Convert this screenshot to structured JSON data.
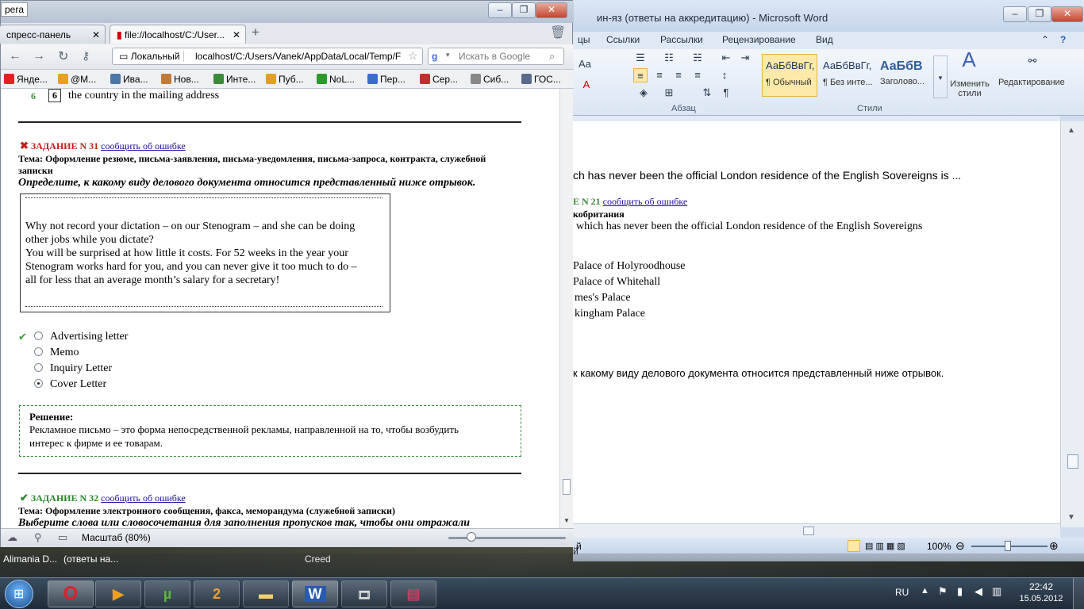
{
  "word": {
    "title": "ин-яз (ответы на аккредитацию)  -  Microsoft Word",
    "tabs": [
      "цы",
      "Ссылки",
      "Рассылки",
      "Рецензирование",
      "Вид"
    ],
    "font_preview": "Aa",
    "groups": {
      "paragraph": "Абзац",
      "styles": "Стили"
    },
    "styles": [
      {
        "sample": "АаБбВвГг,",
        "name": "¶ Обычный"
      },
      {
        "sample": "АаБбВвГг,",
        "name": "¶ Без инте..."
      },
      {
        "sample": "АаБбВ",
        "name": "Заголово..."
      }
    ],
    "change_styles": "Изменить стили",
    "editing": "Редактирование",
    "doc": {
      "line1": "ch has never been the official London residence of the English Sovereigns is ...",
      "task_num": "Е N 21",
      "report_link": "сообщить об ошибке",
      "topic": "кобритания",
      "question": "which has never been the official London residence of the English Sovereigns",
      "options": [
        "Palace of Holyroodhouse",
        "Palace of Whitehall",
        "mes's Palace",
        "kingham Palace"
      ],
      "line_ru": "к какому виду делового документа относится представленный ниже отрывок."
    },
    "status": {
      "left": "й",
      "zoom": "100%"
    }
  },
  "opera": {
    "title_fragment": "pera",
    "tabs": [
      {
        "label": "спресс-панель"
      },
      {
        "label": "file://localhost/C:/User..."
      }
    ],
    "address_label": "Локальный",
    "address": "localhost/C:/Users/Vanek/AppData/Local/Temp/F",
    "search_placeholder": "Искать в Google",
    "bookmarks": [
      {
        "label": "Янде...",
        "color": "#d22"
      },
      {
        "label": "@M...",
        "color": "#e8a020"
      },
      {
        "label": "Ива...",
        "color": "#4a76a8"
      },
      {
        "label": "Нов...",
        "color": "#c07a3a"
      },
      {
        "label": "Инте...",
        "color": "#3a8a3a"
      },
      {
        "label": "Пуб...",
        "color": "#e0a020"
      },
      {
        "label": "NoL...",
        "color": "#2a9a2a"
      },
      {
        "label": "Пер...",
        "color": "#3a6ad0"
      },
      {
        "label": "Сер...",
        "color": "#c03030"
      },
      {
        "label": "Сиб...",
        "color": "#888888"
      },
      {
        "label": "ГОС...",
        "color": "#5a6a8a"
      }
    ],
    "page": {
      "prev_row": {
        "n1": "6",
        "n2": "6",
        "text": "the country in the mailing address"
      },
      "task31": {
        "heading": "ЗАДАНИЕ N 31",
        "report": "сообщить об ошибке",
        "topic_line1": "Тема: Оформление резюме, письма-заявления, письма-уведомления, письма-запроса, контракта, служебной",
        "topic_line2": "записки",
        "instruction": "Определите, к какому виду делового документа относится представленный ниже отрывок.",
        "excerpt": [
          "Why not record your dictation – on our Stenogram – and she can be doing",
          "other jobs while you dictate?",
          "You will be surprised at how little it costs. For 52 weeks in the year your",
          "Stenogram works hard for you, and you can never give it too much to do –",
          "all for less that an average month’s salary for a secretary!"
        ],
        "answers": [
          "Advertising letter",
          "Memo",
          "Inquiry Letter",
          "Cover Letter"
        ],
        "solution_title": "Решение:",
        "solution_text1": "Рекламное письмо – это форма непосредственной рекламы, направленной на то, чтобы возбудить",
        "solution_text2": "интерес к фирме и ее товарам."
      },
      "task32": {
        "heading": "ЗАДАНИЕ N 32",
        "report": "сообщить об ошибке",
        "topic": "Тема: Оформление электронного сообщения, факса, меморандума (служебной записки)",
        "instruction": "Выберите слова или словосочетания для заполнения пропусков так, чтобы они отражали"
      }
    },
    "status_zoom": "Масштаб (80%)"
  },
  "thumbs": [
    "Alimania D...",
    "(ответы на...",
    "Creed",
    "й"
  ],
  "tray": {
    "lang": "RU",
    "time": "22:42",
    "date": "15.05.2012"
  }
}
